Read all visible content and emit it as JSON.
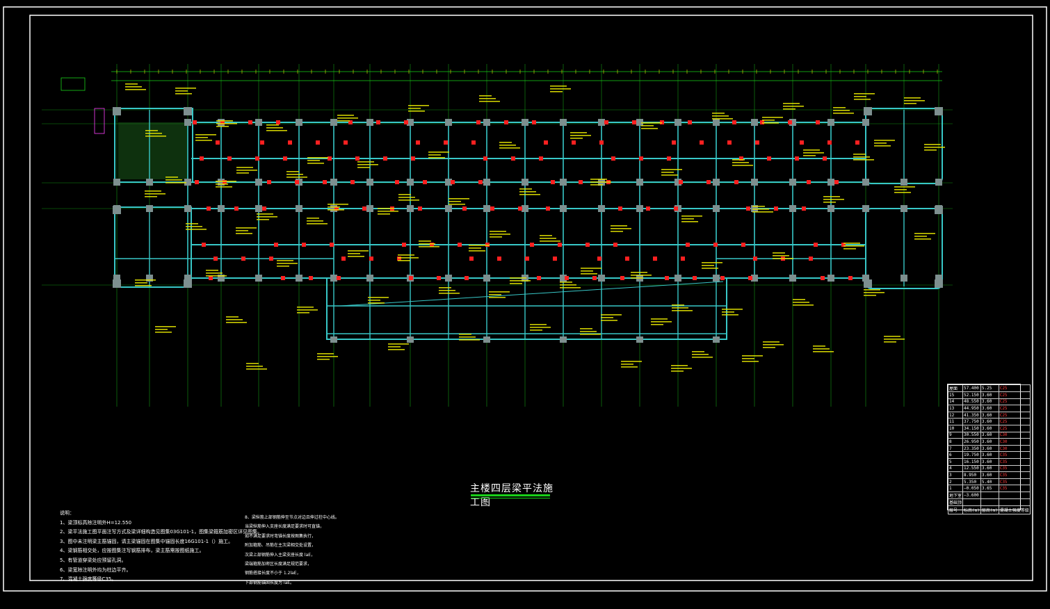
{
  "drawing": {
    "title": "主楼四层梁平法施工图",
    "line_color": "#38c8c8",
    "annotation_color": "#e6e600",
    "grid_color": "#19d119",
    "column_color": "#ff2020",
    "frame_color": "#ffffff"
  },
  "notes": {
    "heading": "说明：",
    "items": [
      "1、梁顶标高除注明外H=12.550",
      "2、梁平法施工图平面注写方式及梁详细构造见图集03G101-1，图集梁箍筋加密区详见图集。",
      "3、图中未注明梁主筋锚固，请主梁锚固在图集中锚固长度16G101-1（）施工。",
      "4、梁钢筋相交处，应按图集注写钢筋排布，梁主筋需按图纸施工。",
      "5、有管道穿梁处应预留孔洞。",
      "6、梁宽除注明外均为柱边平齐。",
      "7、混凝土强度等级C35。"
    ],
    "items_right": [
      "8、梁纵筋上部钢筋伸至节点对边且伸过柱中心线。",
      "当梁纵筋伸入支座长度满足要求时可直锚，",
      "如不满足要求时弯锚长度按图集执行，",
      "附加箍筋、吊筋在主次梁相交处设置，",
      "次梁上部钢筋伸入主梁支座长度 laE，",
      "梁端箍筋加密区长度满足规范要求，",
      "钢筋搭接长度不小于 1.2laE，",
      "下部钢筋锚固长度为 laE。"
    ]
  },
  "floor_table": {
    "rows": [
      [
        "屋面",
        "57.400",
        "5.25",
        "C25"
      ],
      [
        "15",
        "52.150",
        "3.60",
        "C25"
      ],
      [
        "14",
        "48.550",
        "3.60",
        "C25"
      ],
      [
        "13",
        "44.950",
        "3.60",
        "C25"
      ],
      [
        "12",
        "41.350",
        "3.60",
        "C25"
      ],
      [
        "11",
        "37.750",
        "3.60",
        "C25"
      ],
      [
        "10",
        "34.150",
        "3.60",
        "C25"
      ],
      [
        "9",
        "30.550",
        "3.60",
        "C30"
      ],
      [
        "8",
        "26.950",
        "3.60",
        "C30"
      ],
      [
        "7",
        "23.350",
        "3.60",
        "C30"
      ],
      [
        "6",
        "19.750",
        "3.60",
        "C35"
      ],
      [
        "5",
        "16.150",
        "3.60",
        "C35"
      ],
      [
        "4",
        "12.550",
        "3.60",
        "C35"
      ],
      [
        "3",
        "8.950",
        "3.60",
        "C35"
      ],
      [
        "2",
        "5.350",
        "5.40",
        "C35"
      ],
      [
        "1",
        "−0.050",
        "3.65",
        "C35"
      ],
      [
        "地下室",
        "−3.600",
        "",
        ""
      ],
      [
        "基础顶",
        "",
        "",
        ""
      ]
    ],
    "footer": [
      "层号",
      "标高(m)",
      "层高(m)",
      "混凝土强度等级"
    ]
  }
}
